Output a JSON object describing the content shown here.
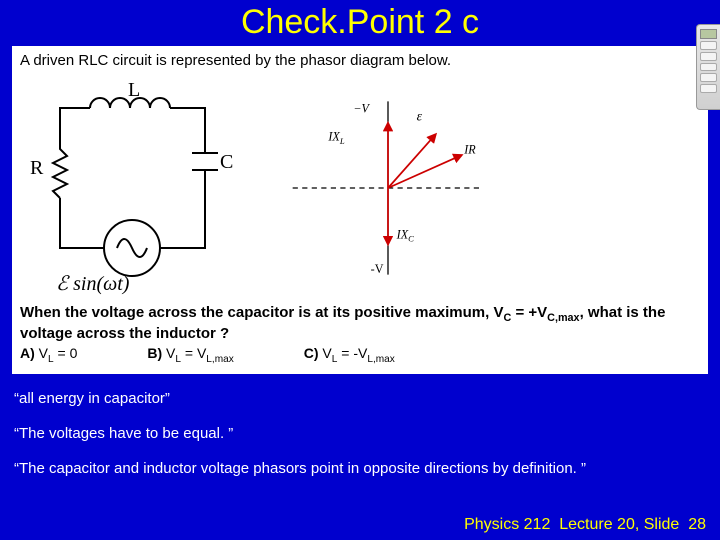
{
  "title": "Check.Point 2 c",
  "question": {
    "intro": "A driven RLC circuit is represented by the phasor diagram below.",
    "prompt_pre": "When the voltage across the capacitor is at its positive maximum, V",
    "prompt_sub1": "C",
    "prompt_mid1": " = +V",
    "prompt_sub2": "C,max",
    "prompt_mid2": ", what is the voltage across the inductor ?",
    "optA_label": "A)",
    "optA_text_pre": " V",
    "optA_sub": "L",
    "optA_text_post": " = 0",
    "optB_label": "B)",
    "optB_text_pre": " V",
    "optB_sub1": "L",
    "optB_mid": " = V",
    "optB_sub2": "L,max",
    "optC_label": "C)",
    "optC_text_pre": " V",
    "optC_sub1": "L",
    "optC_mid": " = -V",
    "optC_sub2": "L,max"
  },
  "circuit": {
    "L": "L",
    "R": "R",
    "C": "C",
    "emf": "ℰ sin(ωt)"
  },
  "phasor": {
    "vneg_top": "−V",
    "eps": "ε",
    "IXL": "IX",
    "IXL_sub": "L",
    "IR": "IR",
    "IXC": "IX",
    "IXC_sub": "C",
    "vneg_bot": "-V"
  },
  "quotes": {
    "q1": "“all energy in capacitor”",
    "q2": "“The voltages have to be equal. ”",
    "q3": "“The capacitor and inductor voltage phasors point in opposite directions by definition. ”"
  },
  "footer": {
    "course": "Physics 212",
    "lecture": "Lecture 20, Slide",
    "slide": "28"
  }
}
